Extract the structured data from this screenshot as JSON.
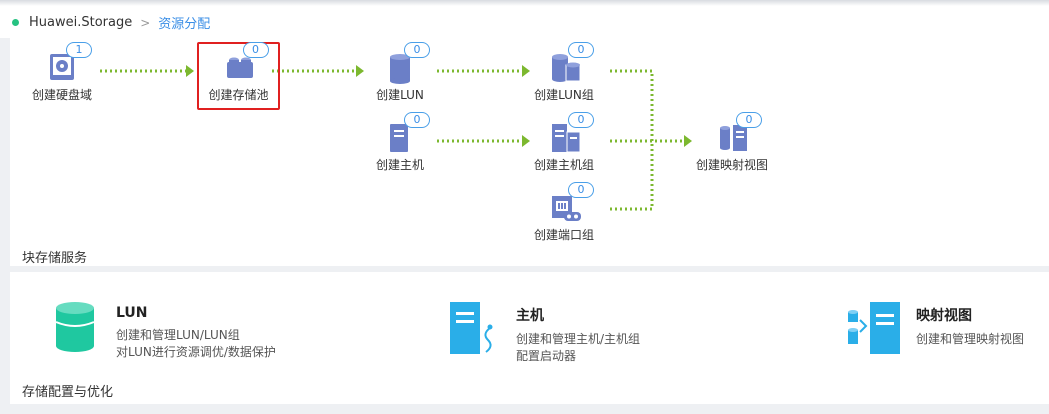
{
  "breadcrumb": {
    "host": "Huawei.Storage",
    "current": "资源分配"
  },
  "workflow": {
    "disk_domain": {
      "label": "创建硬盘域",
      "count": "1"
    },
    "storage_pool": {
      "label": "创建存储池",
      "count": "0"
    },
    "lun": {
      "label": "创建LUN",
      "count": "0"
    },
    "lun_group": {
      "label": "创建LUN组",
      "count": "0"
    },
    "host": {
      "label": "创建主机",
      "count": "0"
    },
    "host_group": {
      "label": "创建主机组",
      "count": "0"
    },
    "port_group": {
      "label": "创建端口组",
      "count": "0"
    },
    "mapping_view": {
      "label": "创建映射视图",
      "count": "0"
    },
    "section_title": "块存储服务"
  },
  "services": {
    "section_title": "存储配置与优化",
    "lun": {
      "title": "LUN",
      "desc1": "创建和管理LUN/LUN组",
      "desc2": "对LUN进行资源调优/数据保护"
    },
    "host": {
      "title": "主机",
      "desc1": "创建和管理主机/主机组",
      "desc2": "配置启动器"
    },
    "mapping": {
      "title": "映射视图",
      "desc1": "创建和管理映射视图"
    }
  },
  "colors": {
    "accent": "#3a8ee6",
    "icon": "#6b7fc7",
    "arrow": "#7cb82f",
    "teal": "#1fc8a0",
    "blue": "#2aaee8",
    "status": "#26c281",
    "highlight": "#e02020"
  }
}
